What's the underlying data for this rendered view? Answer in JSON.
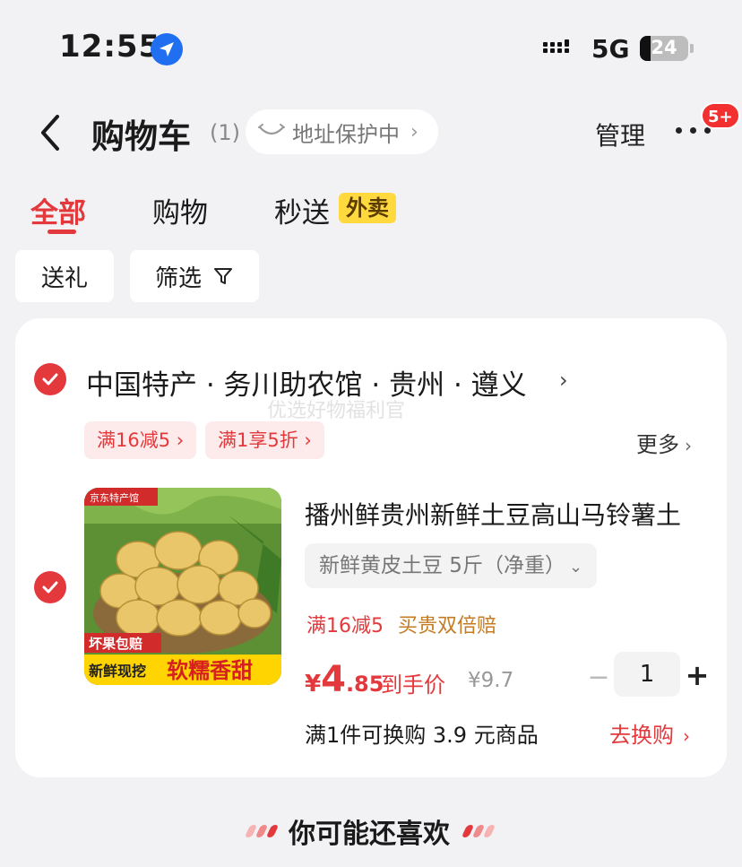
{
  "status_bar": {
    "time": "12:55",
    "network": "5G",
    "battery": "24"
  },
  "header": {
    "title": "购物车",
    "count": "(1)",
    "address_pill": "地址保护中",
    "chevron": "›",
    "manage": "管理",
    "notification_badge": "5+"
  },
  "tabs": [
    {
      "label": "全部",
      "active": true
    },
    {
      "label": "购物",
      "active": false
    },
    {
      "label": "秒送",
      "active": false,
      "tag": "外卖"
    }
  ],
  "filters": {
    "gift": "送礼",
    "filter": "筛选"
  },
  "store": {
    "name": "中国特产 · 务川助农馆 · 贵州 · 遵义",
    "chevron": "›",
    "watermark": "优选好物福利官",
    "promos": [
      "满16减5 ›",
      "满1享5折 ›"
    ],
    "more": "更多",
    "more_chevron": "›"
  },
  "product": {
    "thumb_badge": "京东特产馆",
    "thumb_tag1": "坏果包赔",
    "thumb_tag2": "新鲜现挖",
    "thumb_tag3": "软糯香甜",
    "title": "播州鲜贵州新鲜土豆高山马铃薯土",
    "sku": "新鲜黄皮土豆 5斤（净重）",
    "sku_chevron": "⌄",
    "promo_tag": "满16减5",
    "service_tag": "买贵双倍赔",
    "price_currency": "¥",
    "price_int": "4",
    "price_dec": ".85",
    "price_label": "到手价",
    "original_price": "¥9.7",
    "minus": "−",
    "quantity": "1",
    "plus": "+",
    "exchange_text": "满1件可换购 3.9 元商品",
    "exchange_link": "去换购",
    "exchange_chevron": "›"
  },
  "recommend": {
    "title": "你可能还喜欢"
  },
  "colors": {
    "accent": "#e4393c",
    "tag_yellow": "#ffd93d",
    "background": "#f2f2f4"
  }
}
